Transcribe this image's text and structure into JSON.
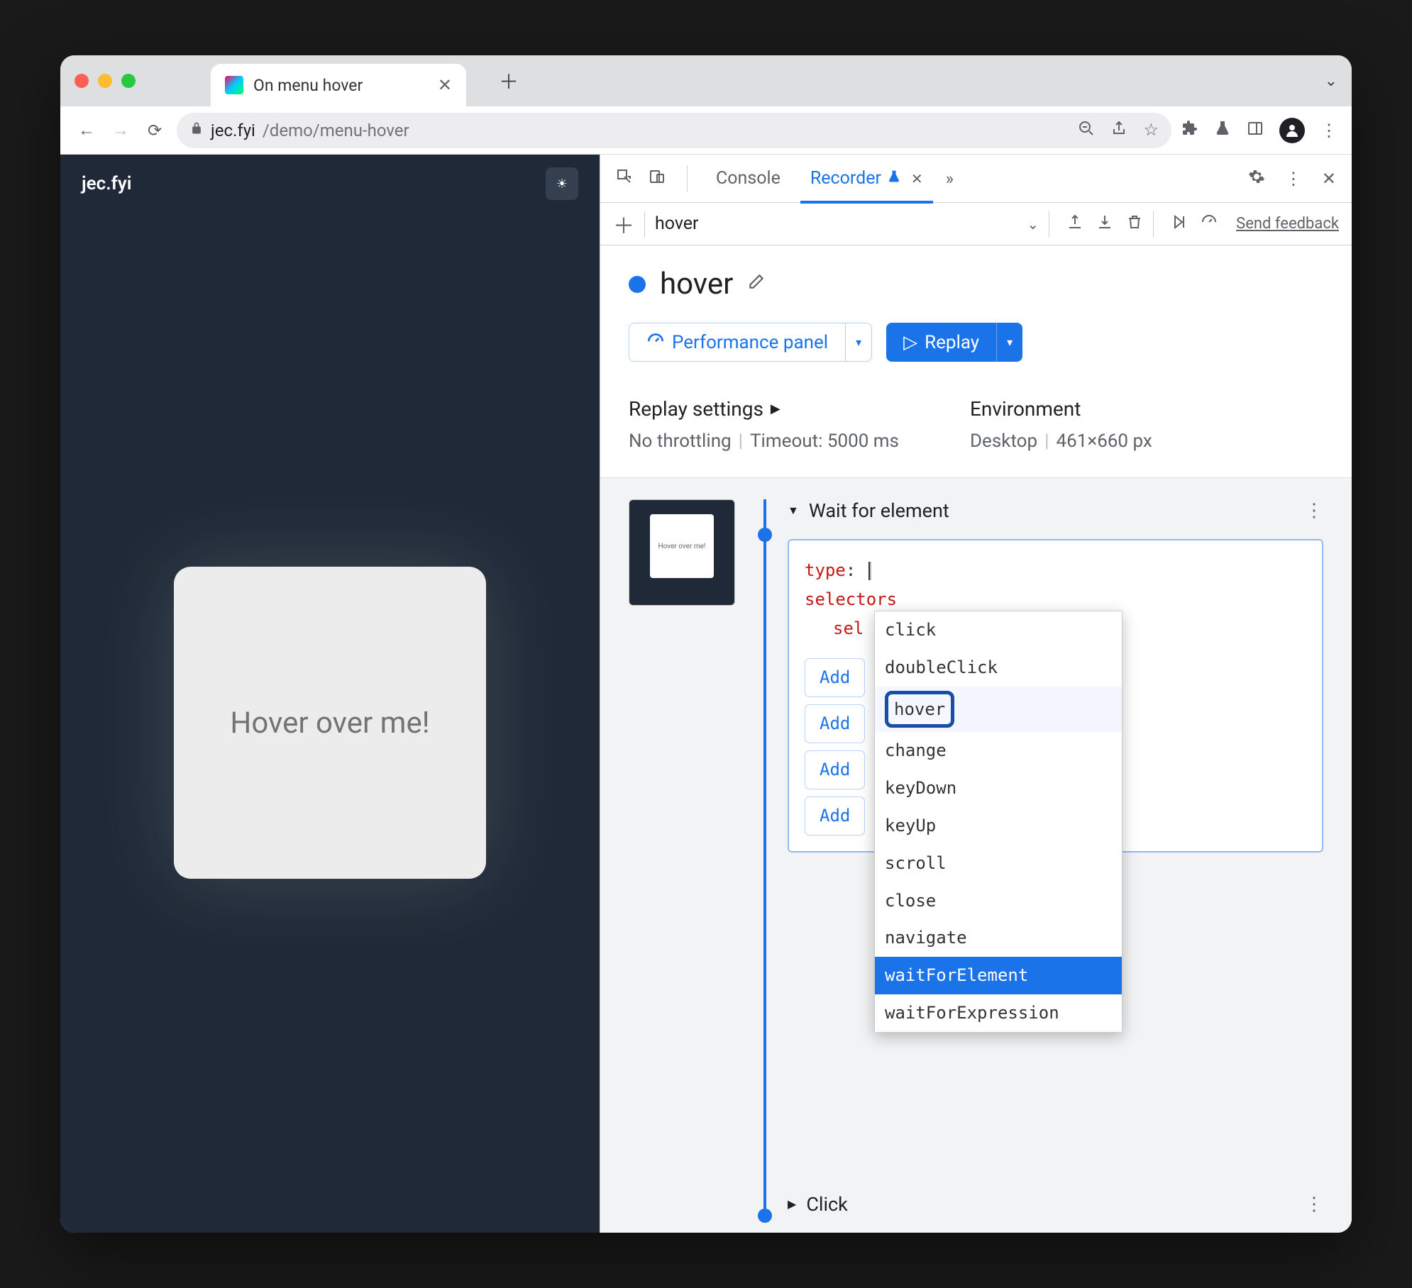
{
  "browser": {
    "tab_title": "On menu hover",
    "url_domain": "jec.fyi",
    "url_path": "/demo/menu-hover"
  },
  "page": {
    "site_title": "jec.fyi",
    "card_text": "Hover over me!"
  },
  "devtools": {
    "tabs": {
      "console": "Console",
      "recorder": "Recorder"
    },
    "recording_name": "hover",
    "feedback": "Send feedback",
    "title": "hover",
    "perf_btn": "Performance panel",
    "replay_btn": "Replay",
    "replay_settings_label": "Replay settings",
    "throttling": "No throttling",
    "timeout": "Timeout: 5000 ms",
    "env_label": "Environment",
    "env_device": "Desktop",
    "env_size": "461×660 px"
  },
  "step": {
    "title": "Wait for element",
    "code": {
      "type_key": "type",
      "selectors_key": "selectors",
      "sel_key": "sel"
    },
    "add_btns": [
      "Add",
      "Add",
      "Add",
      "Add"
    ],
    "step2_title": "Click",
    "thumb_text": "Hover over me!"
  },
  "autocomplete": {
    "items": [
      "click",
      "doubleClick",
      "hover",
      "change",
      "keyDown",
      "keyUp",
      "scroll",
      "close",
      "navigate",
      "waitForElement",
      "waitForExpression"
    ]
  }
}
